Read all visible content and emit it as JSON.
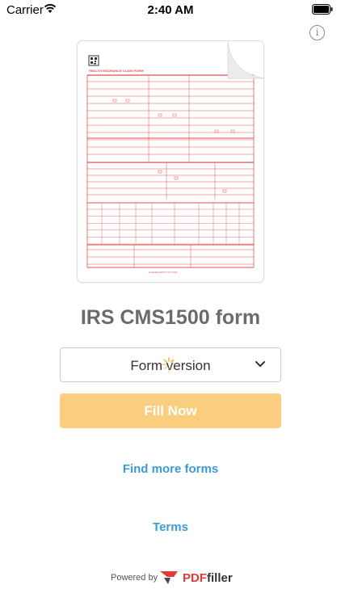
{
  "status_bar": {
    "carrier": "Carrier",
    "time": "2:40 AM"
  },
  "form_thumbnail": {
    "header": "HEALTH INSURANCE CLAIM FORM",
    "footer": "PLEASE PRINT OR TYPE"
  },
  "title": "IRS CMS1500 form",
  "version_select": {
    "label": "Form version"
  },
  "fill_button": "Fill Now",
  "links": {
    "find_more": "Find more forms",
    "terms": "Terms"
  },
  "footer": {
    "powered_by": "Powered by",
    "brand_pdf": "PDF",
    "brand_filler": "filler"
  },
  "colors": {
    "accent_blue": "#3d9ad8",
    "fill_button": "#fbcd7f",
    "form_red": "#e0524f",
    "brand_red": "#e6393a"
  }
}
